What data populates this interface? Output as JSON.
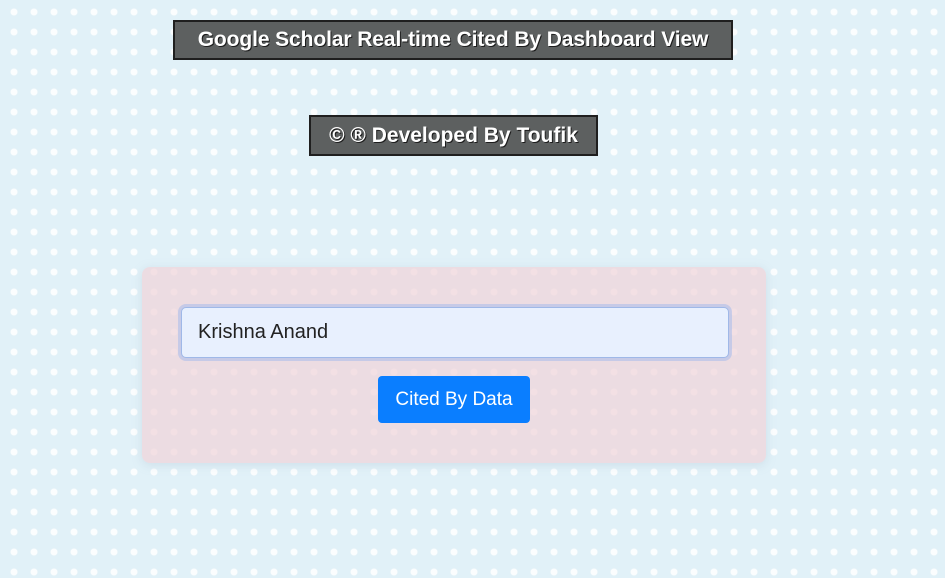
{
  "header": {
    "title": "Google Scholar Real-time Cited By Dashboard View",
    "developer_credit": "© ® Developed By Toufik"
  },
  "search_form": {
    "author_input_value": "Krishna Anand",
    "submit_label": "Cited By Data"
  },
  "colors": {
    "page_background": "#e1f1f8",
    "title_background": "#5d6060",
    "card_background": "#f0d4da",
    "button_primary": "#0a7eff",
    "input_background": "#e8f0fe"
  }
}
